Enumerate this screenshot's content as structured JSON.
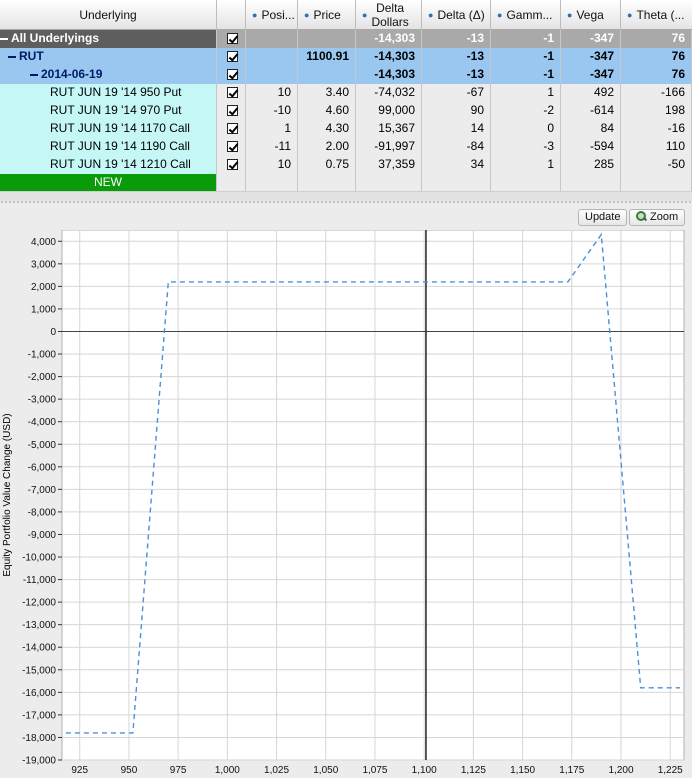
{
  "table": {
    "columns": [
      {
        "key": "underlying",
        "label": "Underlying"
      },
      {
        "key": "include",
        "label": ""
      },
      {
        "key": "position",
        "label": "Posi..."
      },
      {
        "key": "price",
        "label": "Price"
      },
      {
        "key": "delta_dollars",
        "label": "Delta Dollars",
        "label_line1": "Delta",
        "label_line2": "Dollars"
      },
      {
        "key": "delta",
        "label": "Delta (Δ)"
      },
      {
        "key": "gamma",
        "label": "Gamm..."
      },
      {
        "key": "vega",
        "label": "Vega"
      },
      {
        "key": "theta",
        "label": "Theta (..."
      }
    ],
    "rows": [
      {
        "level": "all",
        "underlying": "All Underlyings",
        "checked": true,
        "position": "",
        "price": "",
        "delta_dollars": "-14,303",
        "delta": "-13",
        "gamma": "-1",
        "vega": "-347",
        "theta": "76"
      },
      {
        "level": "symbol",
        "underlying": "RUT",
        "checked": true,
        "position": "",
        "price": "1100.91",
        "delta_dollars": "-14,303",
        "delta": "-13",
        "gamma": "-1",
        "vega": "-347",
        "theta": "76"
      },
      {
        "level": "expiry",
        "underlying": "2014-06-19",
        "checked": true,
        "position": "",
        "price": "",
        "delta_dollars": "-14,303",
        "delta": "-13",
        "gamma": "-1",
        "vega": "-347",
        "theta": "76"
      },
      {
        "level": "leg",
        "underlying": "RUT JUN 19 '14 950 Put",
        "checked": true,
        "position": "10",
        "price": "3.40",
        "delta_dollars": "-74,032",
        "delta": "-67",
        "gamma": "1",
        "vega": "492",
        "theta": "-166"
      },
      {
        "level": "leg",
        "underlying": "RUT JUN 19 '14 970 Put",
        "checked": true,
        "position": "-10",
        "price": "4.60",
        "delta_dollars": "99,000",
        "delta": "90",
        "gamma": "-2",
        "vega": "-614",
        "theta": "198"
      },
      {
        "level": "leg",
        "underlying": "RUT JUN 19 '14 1170 Call",
        "checked": true,
        "position": "1",
        "price": "4.30",
        "delta_dollars": "15,367",
        "delta": "14",
        "gamma": "0",
        "vega": "84",
        "theta": "-16"
      },
      {
        "level": "leg",
        "underlying": "RUT JUN 19 '14 1190 Call",
        "checked": true,
        "position": "-11",
        "price": "2.00",
        "delta_dollars": "-91,997",
        "delta": "-84",
        "gamma": "-3",
        "vega": "-594",
        "theta": "110"
      },
      {
        "level": "leg",
        "underlying": "RUT JUN 19 '14 1210 Call",
        "checked": true,
        "position": "10",
        "price": "0.75",
        "delta_dollars": "37,359",
        "delta": "34",
        "gamma": "1",
        "vega": "285",
        "theta": "-50"
      },
      {
        "level": "new",
        "underlying": "NEW",
        "checked": false,
        "position": "",
        "price": "",
        "delta_dollars": "",
        "delta": "",
        "gamma": "",
        "vega": "",
        "theta": ""
      }
    ]
  },
  "toolbar": {
    "update_label": "Update",
    "zoom_label": "Zoom",
    "zoom_icon": "magnifier-icon"
  },
  "colors": {
    "all_row": "#5e5e5e",
    "symbol_row": "#9ac7ef",
    "expiry_row": "#9ac7ef",
    "leg_row": "#c6f7f7",
    "new_row": "#0a9b0a",
    "series_line": "#4a90d9"
  },
  "chart_data": {
    "type": "line",
    "ylabel": "Equity Portfolio Value Change (USD)",
    "xlabel": "",
    "title": "",
    "xlim": [
      916,
      1232
    ],
    "ylim": [
      -19000,
      4500
    ],
    "x_ticks": [
      925,
      950,
      975,
      1000,
      1025,
      1050,
      1075,
      1100,
      1125,
      1150,
      1175,
      1200,
      1225
    ],
    "x_tick_labels": [
      "925",
      "950",
      "975",
      "1,000",
      "1,025",
      "1,050",
      "1,075",
      "1,100",
      "1,125",
      "1,150",
      "1,175",
      "1,200",
      "1,225"
    ],
    "y_ticks": [
      4000,
      3000,
      2000,
      1000,
      0,
      -1000,
      -2000,
      -3000,
      -4000,
      -5000,
      -6000,
      -7000,
      -8000,
      -9000,
      -10000,
      -11000,
      -12000,
      -13000,
      -14000,
      -15000,
      -16000,
      -17000,
      -18000,
      -19000
    ],
    "y_tick_labels": [
      "4,000",
      "3,000",
      "2,000",
      "1,000",
      "0",
      "-1,000",
      "-2,000",
      "-3,000",
      "-4,000",
      "-5,000",
      "-6,000",
      "-7,000",
      "-8,000",
      "-9,000",
      "-10,000",
      "-11,000",
      "-12,000",
      "-13,000",
      "-14,000",
      "-15,000",
      "-16,000",
      "-17,000",
      "-18,000",
      "-19,000"
    ],
    "current_price": 1100.91,
    "grid": true,
    "series": [
      {
        "line_style": "dashed",
        "x": [
          918,
          952,
          970,
          1173,
          1190,
          1210,
          1230
        ],
        "y": [
          -17800,
          -17800,
          2200,
          2200,
          4300,
          -15800,
          -15800
        ]
      }
    ]
  }
}
